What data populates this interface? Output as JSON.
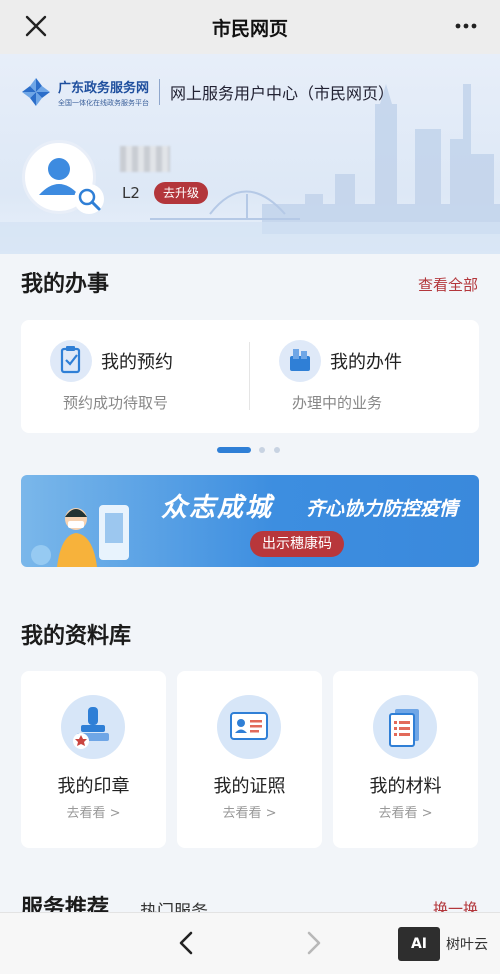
{
  "topbar": {
    "title": "市民网页"
  },
  "header": {
    "logo_name": "广东政务服务网",
    "logo_tagline": "全国一体化在线政务服务平台",
    "center_title": "网上服务用户中心（市民网页）"
  },
  "user": {
    "level": "L2",
    "upgrade_label": "去升级"
  },
  "my_affairs": {
    "title": "我的办事",
    "view_all": "查看全部",
    "items": [
      {
        "title": "我的预约",
        "subtitle": "预约成功待取号"
      },
      {
        "title": "我的办件",
        "subtitle": "办理中的业务"
      }
    ]
  },
  "banner": {
    "title": "众志成城",
    "subtitle": "齐心协力防控疫情",
    "button": "出示穗康码"
  },
  "library": {
    "title": "我的资料库",
    "items": [
      {
        "title": "我的印章",
        "subtitle": "去看看 >"
      },
      {
        "title": "我的证照",
        "subtitle": "去看看 >"
      },
      {
        "title": "我的材料",
        "subtitle": "去看看 >"
      }
    ]
  },
  "recommend": {
    "title": "服务推荐",
    "subtitle": "热门服务",
    "swap": "换一换"
  },
  "watermark": {
    "box": "AI",
    "text": "树叶云"
  },
  "colors": {
    "accent_red": "#b3363b",
    "accent_blue": "#2f7fd6"
  }
}
